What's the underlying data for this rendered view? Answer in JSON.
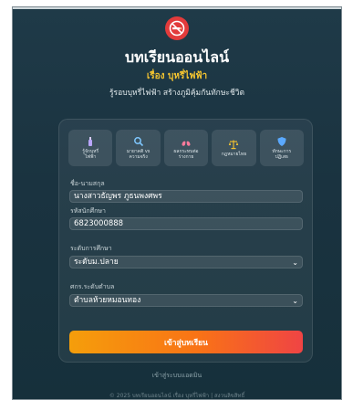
{
  "header": {
    "logo_icon": "no-smoking-icon",
    "title": "บทเรียนออนไลน์",
    "subtitle": "เรื่อง บุหรี่ไฟฟ้า",
    "tagline": "รู้รอบบุหรี่ไฟฟ้า สร้างภูมิคุ้มกันทักษะชีวิต"
  },
  "features": [
    {
      "icon": "vape-icon",
      "label": "รู้จักบุหรี่\nไฟฟ้า",
      "color": "#b9a6ff"
    },
    {
      "icon": "search-icon",
      "label": "มายาคติ vs\nความจริง",
      "color": "#7fc8ff"
    },
    {
      "icon": "lungs-icon",
      "label": "ผลกระทบต่อ\nร่างกาย",
      "color": "#ff7b9c"
    },
    {
      "icon": "scales-icon",
      "label": "กฎหมายไทย",
      "color": "#f4c430"
    },
    {
      "icon": "shield-icon",
      "label": "ทักษะการ\nปฏิเสธ",
      "color": "#5aa9ff"
    }
  ],
  "form": {
    "name_label": "ชื่อ-นามสกุล",
    "name_value": "นางสาวธัญพร ภูธนพงศพร",
    "id_label": "รหัสนักศึกษา",
    "id_value": "6823000888",
    "level_label": "ระดับการศึกษา",
    "level_value": "ระดับม.ปลาย",
    "district_label": "ศกร.ระดับตำบล",
    "district_value": "ตำบลห้วยหมอนทอง",
    "submit_label": "เข้าสู่บทเรียน"
  },
  "admin_link": "เข้าสู่ระบบแอดมิน",
  "footer": "© 2025 บทเรียนออนไลน์ เรื่อง บุหรี่ไฟฟ้า | สงวนลิขสิทธิ์"
}
